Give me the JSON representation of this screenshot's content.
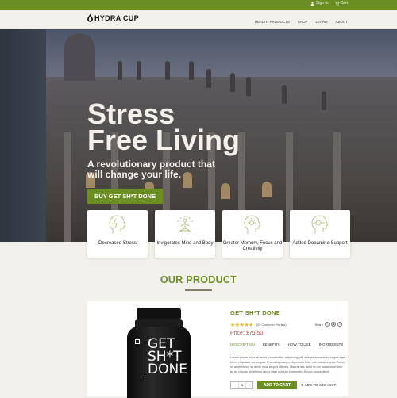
{
  "topbar": {
    "sign_in": "Sign In",
    "cart": "Cart"
  },
  "header": {
    "logo": "HYDRA CUP",
    "nav": [
      "HEALTH PRODUCTS",
      "SHOP",
      "LEARN",
      "ABOUT"
    ]
  },
  "hero": {
    "title_line1": "Stress",
    "title_line2": "Free Living",
    "subtitle": "A revolutionary product that will change your life.",
    "cta": "BUY GET SH*T DONE"
  },
  "features": [
    {
      "label": "Decreased Stress",
      "icon": "head-lightning-icon"
    },
    {
      "label": "Invigorates Mind and Body",
      "icon": "meditation-icon"
    },
    {
      "label": "Greater Memory, Focus and Creativity",
      "icon": "head-lightbulb-icon"
    },
    {
      "label": "Added Dopamine Support",
      "icon": "head-brain-icon"
    }
  ],
  "product_section": {
    "title": "OUR PRODUCT"
  },
  "product": {
    "bottle_text": [
      "GET",
      "SH*T",
      "DONE"
    ],
    "name": "GET SH*T DONE",
    "rating": 5,
    "stars": "★★★★★",
    "reviews": "(20 Customer Review)",
    "share_label": "Share",
    "price": "Price: $75.50",
    "tabs": [
      "DESCRIPTION",
      "BENEFITS",
      "HOW TO USE",
      "INGREDIENTS"
    ],
    "description": "Lorem ipsum dolor sit amet, consectetur adipiscing elit. Integer accumsan magna eget tortor vulputate consequat. Praesent posuere dignissim felis, non sodales urna. Donec sit amet lectus sit amet risus aliquet ultrices. Mauris nec dolor eu mi auctor interdum ac eu mauris. In ultrices lacus vitae pretium commodo. Donec consectetur",
    "quantity": "1",
    "qty_minus": "-",
    "qty_plus": "+",
    "add_to_cart": "ADD TO CART",
    "wishlist": "ADD TO WISHLIST"
  },
  "colors": {
    "brand_green": "#6b8e23",
    "price_red": "#b0504a",
    "star_gold": "#e8b923"
  }
}
